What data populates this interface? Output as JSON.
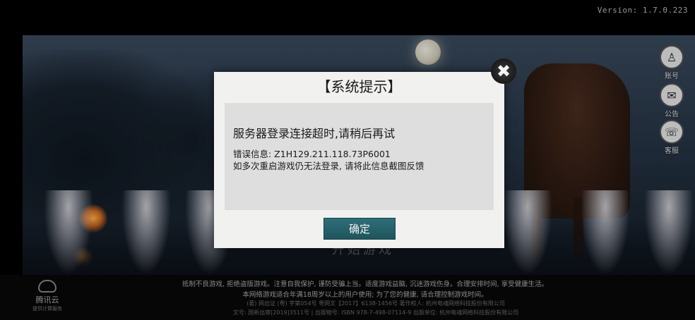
{
  "version": "Version: 1.7.0.223",
  "start_text": "开始游戏",
  "side_menu": [
    {
      "label": "账号",
      "icon": "account-icon"
    },
    {
      "label": "公告",
      "icon": "notice-icon"
    },
    {
      "label": "客服",
      "icon": "support-icon"
    }
  ],
  "dialog": {
    "title": "【系统提示】",
    "message": "服务器登录连接超时,请稍后再试",
    "error_info": "错误信息: Z1H129.211.118.73P6001",
    "hint": "如多次重启游戏仍无法登录, 请将此信息截图反馈",
    "confirm_label": "确定"
  },
  "footer": {
    "line1": "抵制不良游戏, 拒绝盗版游戏。注意自我保护, 谨防受骗上当。适度游戏益脑, 沉迷游戏伤身。合理安排时间, 享受健康生活。",
    "line2": "本网络游戏适合年满18周岁以上的用户使用; 为了您的健康, 请合理控制游戏时间。",
    "line3": "(著) 网出证 (粤) 字第054号 粤网文【2017】6138-1456号 著作权人: 杭州电魂网络科技股份有限公司",
    "line4": "文号: 国新出审[2019]3511号 | 出版物号: ISBN 978-7-498-07114-9 出版单位: 杭州电魂网络科技股份有限公司"
  },
  "branding": {
    "name": "腾讯云",
    "sub": "提供计算服务"
  }
}
